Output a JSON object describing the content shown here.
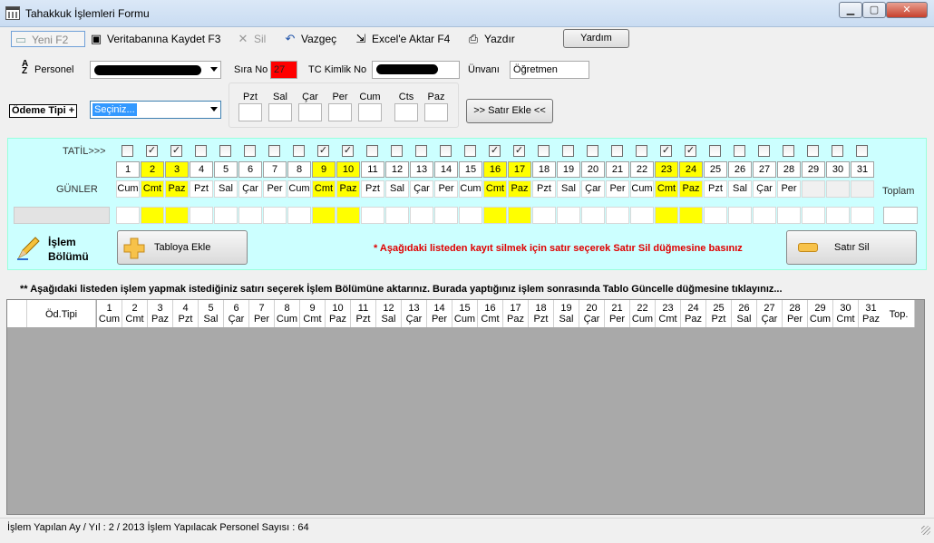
{
  "window": {
    "title": "Tahakkuk İşlemleri Formu",
    "min_label": "▁",
    "max_label": "▢",
    "close_label": "✕"
  },
  "toolbar": {
    "new_label": "Yeni  F2",
    "save_label": "Veritabanına Kaydet F3",
    "delete_label": "Sil",
    "cancel_label": "Vazgeç",
    "excel_label": "Excel'e Aktar  F4",
    "print_label": "Yazdır",
    "help_label": "Yardım"
  },
  "form": {
    "personel_label": "Personel",
    "sira_label": "Sıra No",
    "sira_value": "27",
    "tc_label": "TC Kimlik No",
    "unvan_label": "Ünvanı",
    "unvan_value": "Öğretmen",
    "odeme_label": "Ödeme Tipi +",
    "odeme_value": "Seçiniz...",
    "weekday_labels": [
      "Pzt",
      "Sal",
      "Çar",
      "Per",
      "Cum",
      "Cts",
      "Paz"
    ],
    "add_row_label": ">> Satır Ekle <<"
  },
  "calendar": {
    "tatil_label": "TATİL>>>",
    "gunler_label": "GÜNLER",
    "toplam_label": "Toplam",
    "checked_days": [
      2,
      3,
      9,
      10,
      16,
      17,
      23,
      24
    ],
    "highlight_color": "#ffff00",
    "days": [
      {
        "num": "1",
        "name": "Cum"
      },
      {
        "num": "2",
        "name": "Cmt"
      },
      {
        "num": "3",
        "name": "Paz"
      },
      {
        "num": "4",
        "name": "Pzt"
      },
      {
        "num": "5",
        "name": "Sal"
      },
      {
        "num": "6",
        "name": "Çar"
      },
      {
        "num": "7",
        "name": "Per"
      },
      {
        "num": "8",
        "name": "Cum"
      },
      {
        "num": "9",
        "name": "Cmt"
      },
      {
        "num": "10",
        "name": "Paz"
      },
      {
        "num": "11",
        "name": "Pzt"
      },
      {
        "num": "12",
        "name": "Sal"
      },
      {
        "num": "13",
        "name": "Çar"
      },
      {
        "num": "14",
        "name": "Per"
      },
      {
        "num": "15",
        "name": "Cum"
      },
      {
        "num": "16",
        "name": "Cmt"
      },
      {
        "num": "17",
        "name": "Paz"
      },
      {
        "num": "18",
        "name": "Pzt"
      },
      {
        "num": "19",
        "name": "Sal"
      },
      {
        "num": "20",
        "name": "Çar"
      },
      {
        "num": "21",
        "name": "Per"
      },
      {
        "num": "22",
        "name": "Cum"
      },
      {
        "num": "23",
        "name": "Cmt"
      },
      {
        "num": "24",
        "name": "Paz"
      },
      {
        "num": "25",
        "name": "Pzt"
      },
      {
        "num": "26",
        "name": "Sal"
      },
      {
        "num": "27",
        "name": "Çar"
      },
      {
        "num": "28",
        "name": "Per"
      },
      {
        "num": "29",
        "name": ""
      },
      {
        "num": "30",
        "name": ""
      },
      {
        "num": "31",
        "name": ""
      }
    ]
  },
  "islem": {
    "title_line1": "İşlem",
    "title_line2": "Bölümü",
    "add_table_label": "Tabloya Ekle",
    "warning": "* Aşağıdaki listeden kayıt silmek için satır seçerek Satır Sil düğmesine basınız",
    "delete_row_label": "Satır Sil"
  },
  "info": "** Aşağıdaki listeden işlem yapmak istediğiniz satırı seçerek İşlem Bölümüne aktarınız. Burada yaptığınız işlem sonrasında Tablo Güncelle düğmesine tıklayınız...",
  "grid": {
    "odtipi_label": "Öd.Tipi",
    "top_label": "Top.",
    "columns": [
      {
        "num": "1",
        "name": "Cum"
      },
      {
        "num": "2",
        "name": "Cmt"
      },
      {
        "num": "3",
        "name": "Paz"
      },
      {
        "num": "4",
        "name": "Pzt"
      },
      {
        "num": "5",
        "name": "Sal"
      },
      {
        "num": "6",
        "name": "Çar"
      },
      {
        "num": "7",
        "name": "Per"
      },
      {
        "num": "8",
        "name": "Cum"
      },
      {
        "num": "9",
        "name": "Cmt"
      },
      {
        "num": "10",
        "name": "Paz"
      },
      {
        "num": "11",
        "name": "Pzt"
      },
      {
        "num": "12",
        "name": "Sal"
      },
      {
        "num": "13",
        "name": "Çar"
      },
      {
        "num": "14",
        "name": "Per"
      },
      {
        "num": "15",
        "name": "Cum"
      },
      {
        "num": "16",
        "name": "Cmt"
      },
      {
        "num": "17",
        "name": "Paz"
      },
      {
        "num": "18",
        "name": "Pzt"
      },
      {
        "num": "19",
        "name": "Sal"
      },
      {
        "num": "20",
        "name": "Çar"
      },
      {
        "num": "21",
        "name": "Per"
      },
      {
        "num": "22",
        "name": "Cum"
      },
      {
        "num": "23",
        "name": "Cmt"
      },
      {
        "num": "24",
        "name": "Paz"
      },
      {
        "num": "25",
        "name": "Pzt"
      },
      {
        "num": "26",
        "name": "Sal"
      },
      {
        "num": "27",
        "name": "Çar"
      },
      {
        "num": "28",
        "name": "Per"
      },
      {
        "num": "29",
        "name": "Cum"
      },
      {
        "num": "30",
        "name": "Cmt"
      },
      {
        "num": "31",
        "name": "Paz"
      }
    ]
  },
  "status": {
    "text": "İşlem Yapılan Ay / Yıl :  2 / 2013  İşlem Yapılacak Personel Sayısı :  64"
  }
}
